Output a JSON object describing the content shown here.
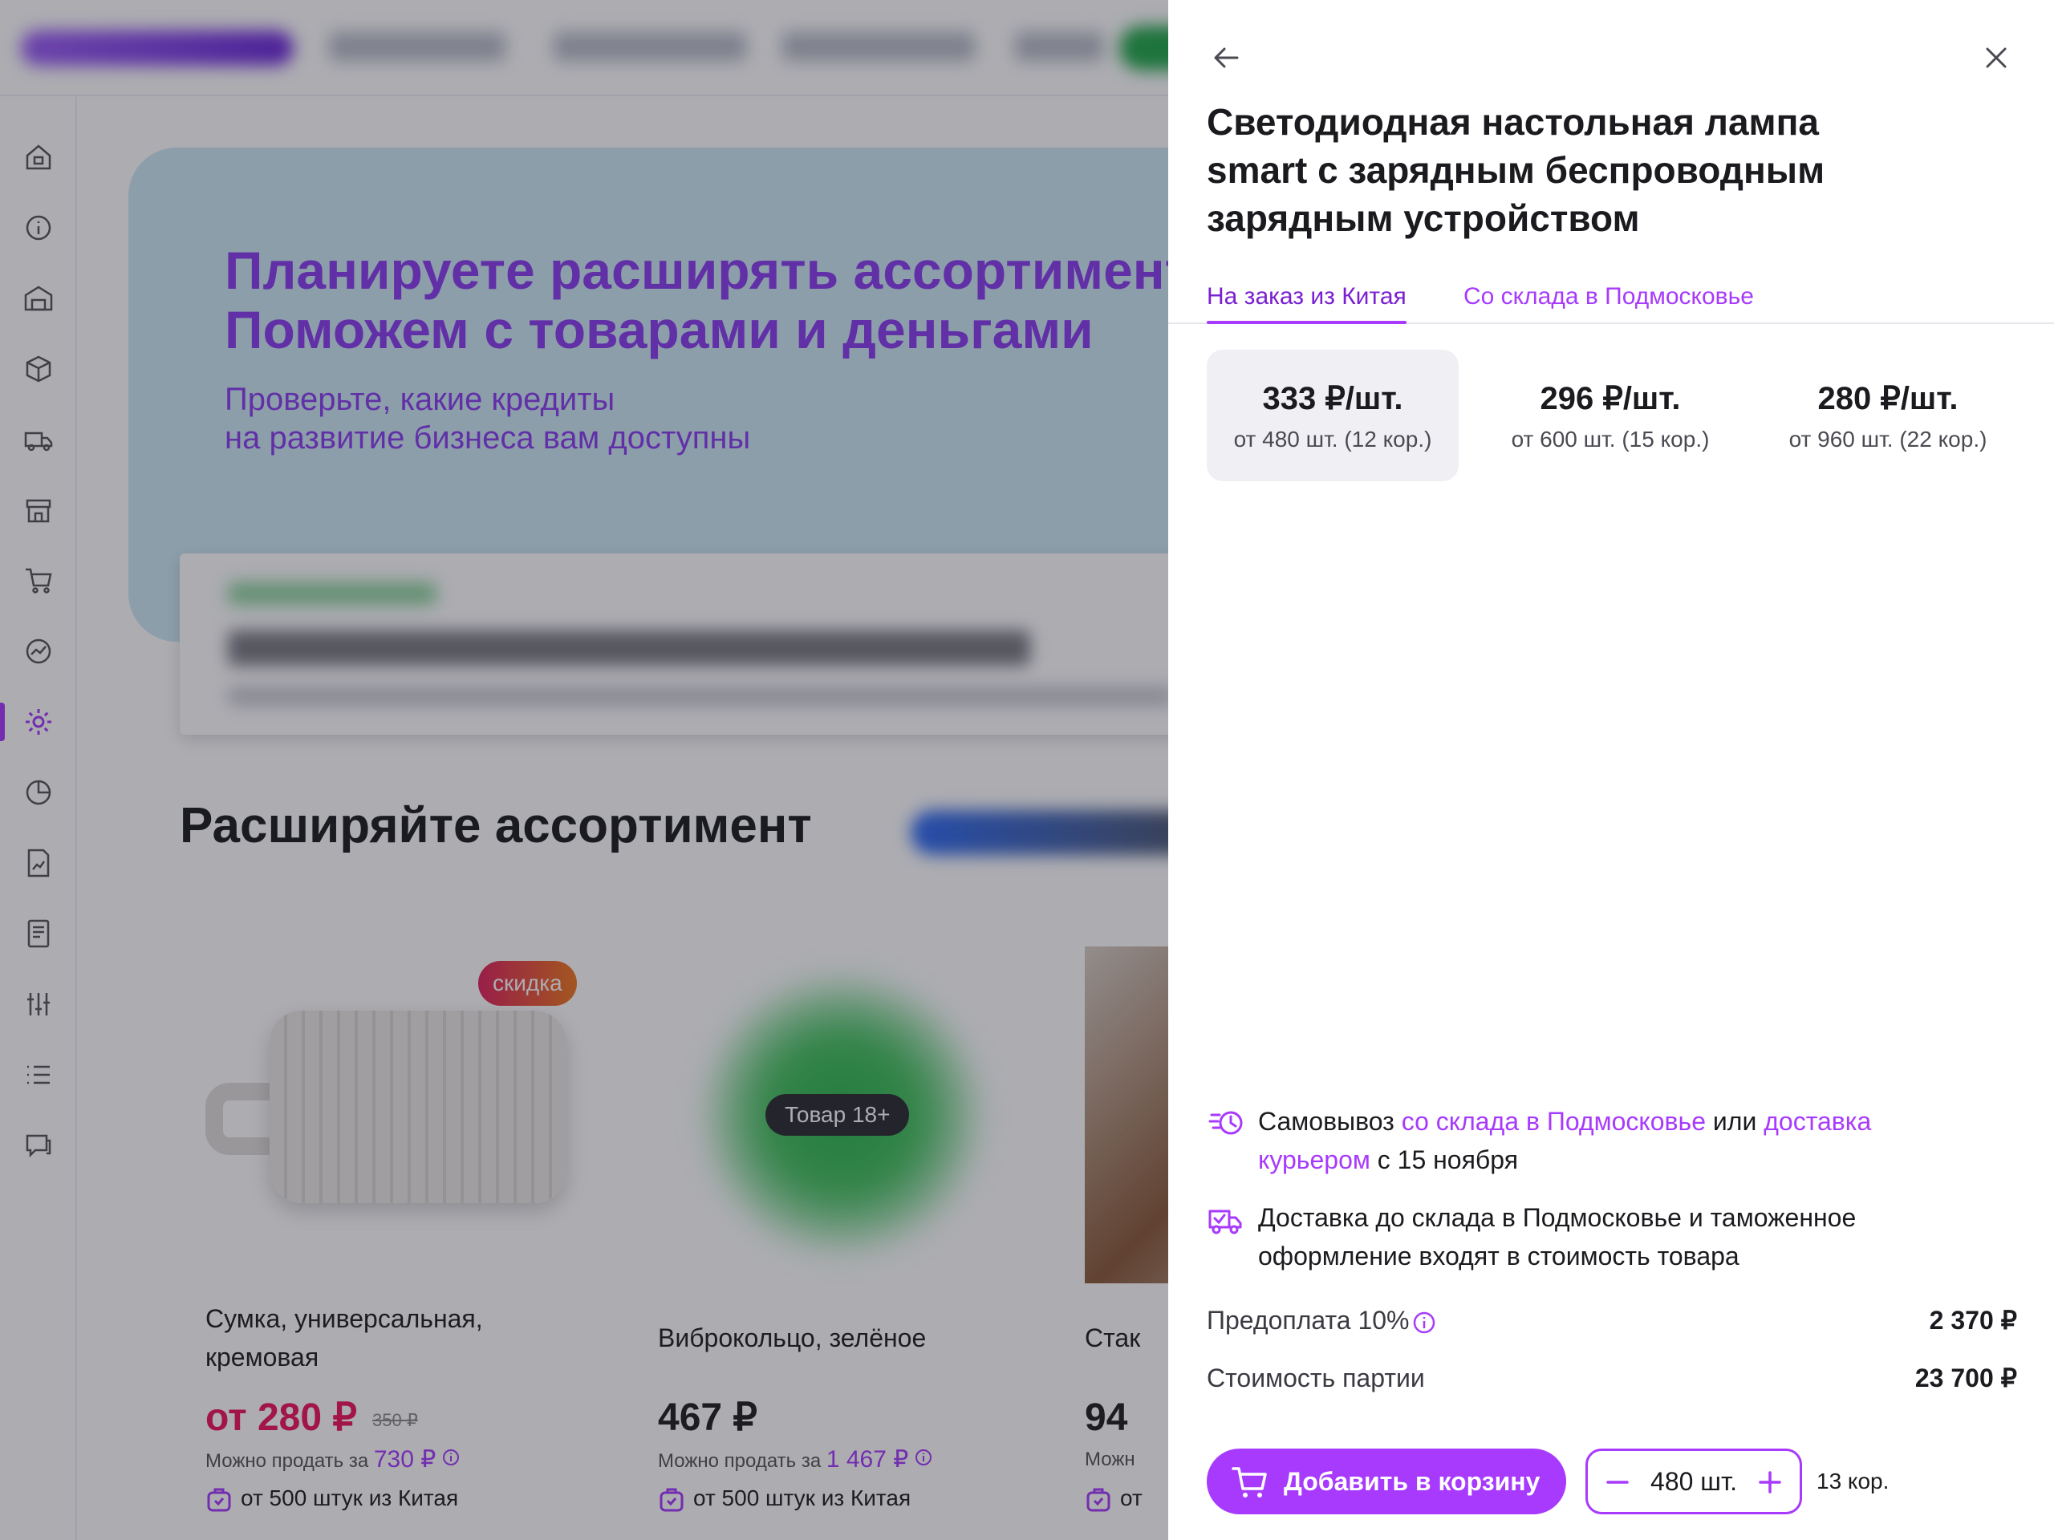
{
  "colors": {
    "accent": "#a73afd",
    "discount_red": "#f0145a",
    "text": "#1b1b1f",
    "muted": "#4a4a52"
  },
  "background": {
    "hero": {
      "title": "Планируете расширять ассортимент?\nПоможем с товарами и деньгами",
      "subtitle": "Проверьте, какие кредиты\nна развитие бизнеса вам доступны"
    },
    "section_title": "Расширяйте ассортимент",
    "sidebar_icons": [
      "home-icon",
      "info-icon",
      "warehouse-icon",
      "box-icon",
      "truck-icon",
      "store-icon",
      "cart-icon",
      "analytics-icon",
      "settings-icon",
      "pie-chart-icon",
      "report-icon",
      "document-icon",
      "filters-icon",
      "list-icon",
      "chat-icon"
    ],
    "cards": [
      {
        "badge": "скидка",
        "name": "Сумка, универсальная, кремовая",
        "price": "от 280 ₽",
        "old_price": "350 ₽",
        "sell_label": "Можно продать за",
        "sell_value": "730 ₽",
        "source": "от 500 штук из Китая"
      },
      {
        "badge": "Товар 18+",
        "name": "Виброкольцо, зелёное",
        "price": "467 ₽",
        "sell_label": "Можно продать за",
        "sell_value": "1 467 ₽",
        "source": "от 500 штук из Китая"
      },
      {
        "name": "Стак",
        "price": "94",
        "sell_label": "Можн",
        "source": "от"
      }
    ]
  },
  "drawer": {
    "title": "Светодиодная настольная лампа smart с зарядным беспроводным зарядным устройством",
    "tabs": [
      {
        "label": "На заказ из Китая",
        "active": true
      },
      {
        "label": "Со склада в Подмосковье",
        "active": false
      }
    ],
    "tiers": [
      {
        "price": "333 ₽/шт.",
        "qty": "от 480 шт. (12 кор.)",
        "selected": true
      },
      {
        "price": "296 ₽/шт.",
        "qty": "от 600 шт. (15 кор.)",
        "selected": false
      },
      {
        "price": "280 ₽/шт.",
        "qty": "от 960 шт. (22 кор.)",
        "selected": false
      }
    ],
    "pickup": {
      "text1": "Самовывоз ",
      "link1": "со склада в Подмосковье",
      "text2": " или ",
      "link2": "доставка курьером",
      "text3": " с 15 ноября"
    },
    "delivery_note": "Доставка до склада в Подмосковье и таможенное оформление входят в стоимость товара",
    "prepayment": {
      "label": "Предоплата 10%",
      "value": "2 370 ₽"
    },
    "batch_cost": {
      "label": "Стоимость партии",
      "value": "23 700 ₽"
    },
    "add_to_cart": "Добавить в корзину",
    "quantity": "480 шт.",
    "boxes": "13 кор."
  }
}
